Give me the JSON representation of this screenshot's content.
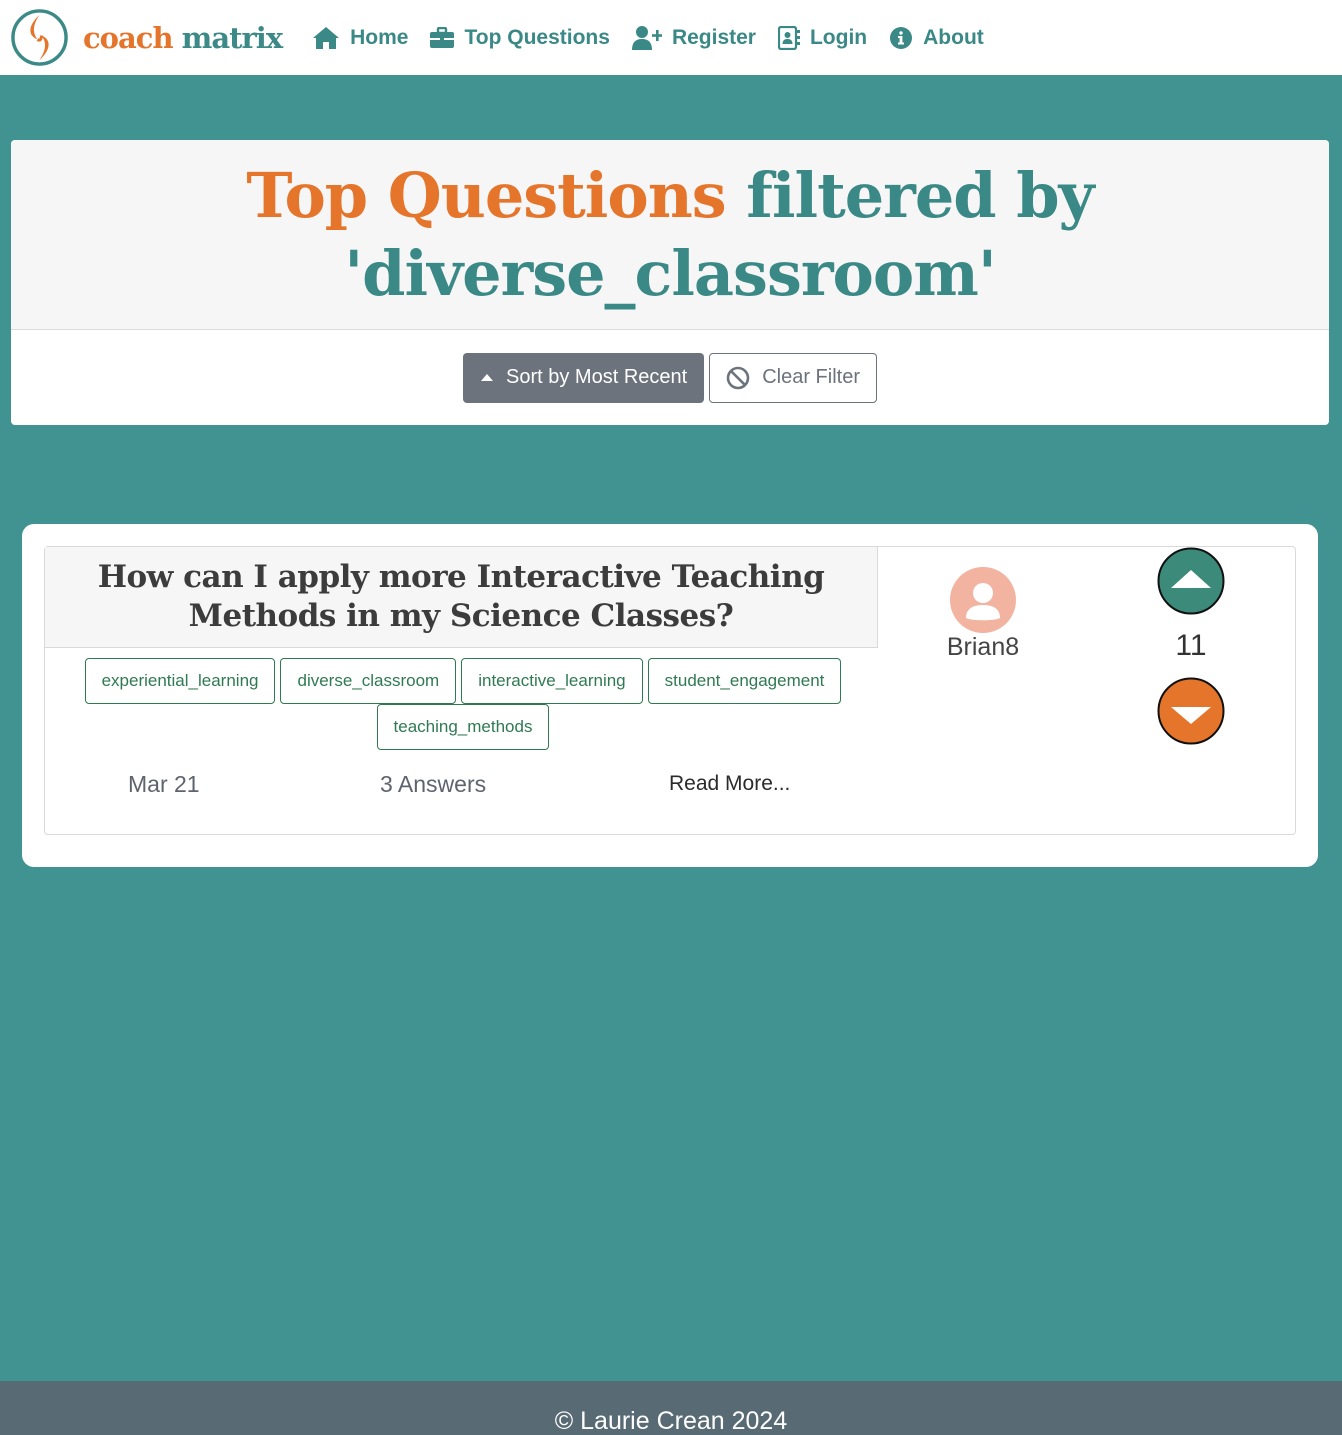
{
  "brand": {
    "word1": "coach",
    "word2": "matrix"
  },
  "nav": {
    "items": [
      {
        "label": "Home",
        "icon": "home-icon"
      },
      {
        "label": "Top Questions",
        "icon": "briefcase-icon"
      },
      {
        "label": "Register",
        "icon": "user-plus-icon"
      },
      {
        "label": "Login",
        "icon": "address-book-icon"
      },
      {
        "label": "About",
        "icon": "info-circle-icon"
      }
    ]
  },
  "header": {
    "title_accent": "Top Questions",
    "title_rest": " filtered by 'diverse_classroom'",
    "sort_label": "Sort by Most Recent",
    "clear_label": "Clear Filter"
  },
  "question": {
    "title": "How can I apply more Interactive Teaching Methods in my Science Classes?",
    "tags": [
      "experiential_learning",
      "diverse_classroom",
      "interactive_learning",
      "student_engagement",
      "teaching_methods"
    ],
    "date": "Mar 21",
    "answers": "3 Answers",
    "read_more": "Read More...",
    "author": "Brian8",
    "votes": "11"
  },
  "footer": {
    "text": "© Laurie Crean 2024"
  },
  "colors": {
    "background": "#409391",
    "accent_orange": "#e4752b",
    "teal": "#3a8986",
    "footer": "#586a74"
  }
}
